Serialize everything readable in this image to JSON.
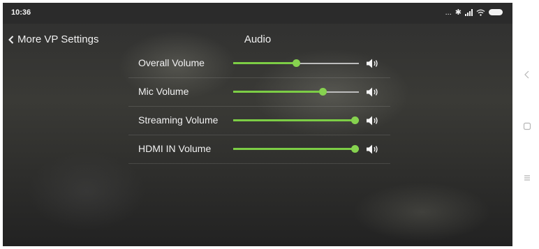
{
  "status_bar": {
    "time": "10:36",
    "dots": "...",
    "bluetooth": "✱",
    "icons": [
      "bluetooth-icon",
      "signal-icon",
      "wifi-icon",
      "battery-icon"
    ]
  },
  "header": {
    "back_label": "More VP Settings",
    "title": "Audio"
  },
  "colors": {
    "accent": "#7ccd45",
    "track": "#bdbdbd",
    "text": "#f2f2f2"
  },
  "volumes": [
    {
      "label": "Overall Volume",
      "level": 0.5
    },
    {
      "label": "Mic Volume",
      "level": 0.71
    },
    {
      "label": "Streaming Volume",
      "level": 1.0
    },
    {
      "label": "HDMI IN Volume",
      "level": 1.0
    }
  ],
  "nav_bar": {
    "icons": [
      "back-nav-icon",
      "home-nav-icon",
      "recents-nav-icon"
    ]
  }
}
